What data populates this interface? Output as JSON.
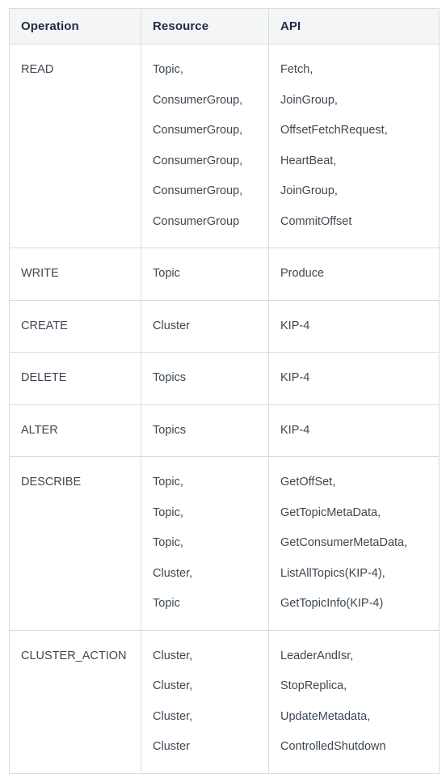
{
  "table": {
    "name": "kafka-acl-operations-table",
    "columns": [
      {
        "key": "operation",
        "label": "Operation"
      },
      {
        "key": "resource",
        "label": "Resource"
      },
      {
        "key": "api",
        "label": "API"
      }
    ],
    "rows": [
      {
        "operation": "READ",
        "resources": [
          "Topic,",
          "ConsumerGroup,",
          "ConsumerGroup,",
          "ConsumerGroup,",
          "ConsumerGroup,",
          "ConsumerGroup"
        ],
        "apis": [
          "Fetch,",
          "JoinGroup,",
          "OffsetFetchRequest,",
          "HeartBeat,",
          "JoinGroup,",
          "CommitOffset"
        ]
      },
      {
        "operation": "WRITE",
        "resources": [
          "Topic"
        ],
        "apis": [
          "Produce"
        ]
      },
      {
        "operation": "CREATE",
        "resources": [
          "Cluster"
        ],
        "apis": [
          "KIP-4"
        ]
      },
      {
        "operation": "DELETE",
        "resources": [
          "Topics"
        ],
        "apis": [
          "KIP-4"
        ]
      },
      {
        "operation": "ALTER",
        "resources": [
          "Topics"
        ],
        "apis": [
          "KIP-4"
        ]
      },
      {
        "operation": "DESCRIBE",
        "resources": [
          "Topic,",
          "Topic,",
          "Topic,",
          "Cluster,",
          "Topic"
        ],
        "apis": [
          "GetOffSet,",
          "GetTopicMetaData,",
          "GetConsumerMetaData,",
          "ListAllTopics(KIP-4),",
          "GetTopicInfo(KIP-4)"
        ]
      },
      {
        "operation": "CLUSTER_ACTION",
        "resources": [
          "Cluster,",
          "Cluster,",
          "Cluster,",
          "Cluster"
        ],
        "apis": [
          "LeaderAndIsr,",
          "StopReplica,",
          "UpdateMetadata,",
          "ControlledShutdown"
        ]
      }
    ]
  },
  "colors": {
    "header_background": "#f4f5f6",
    "header_text": "#1f2a44",
    "body_text": "#3d4852",
    "border": "#d9dcdf",
    "page_background": "#ffffff"
  }
}
